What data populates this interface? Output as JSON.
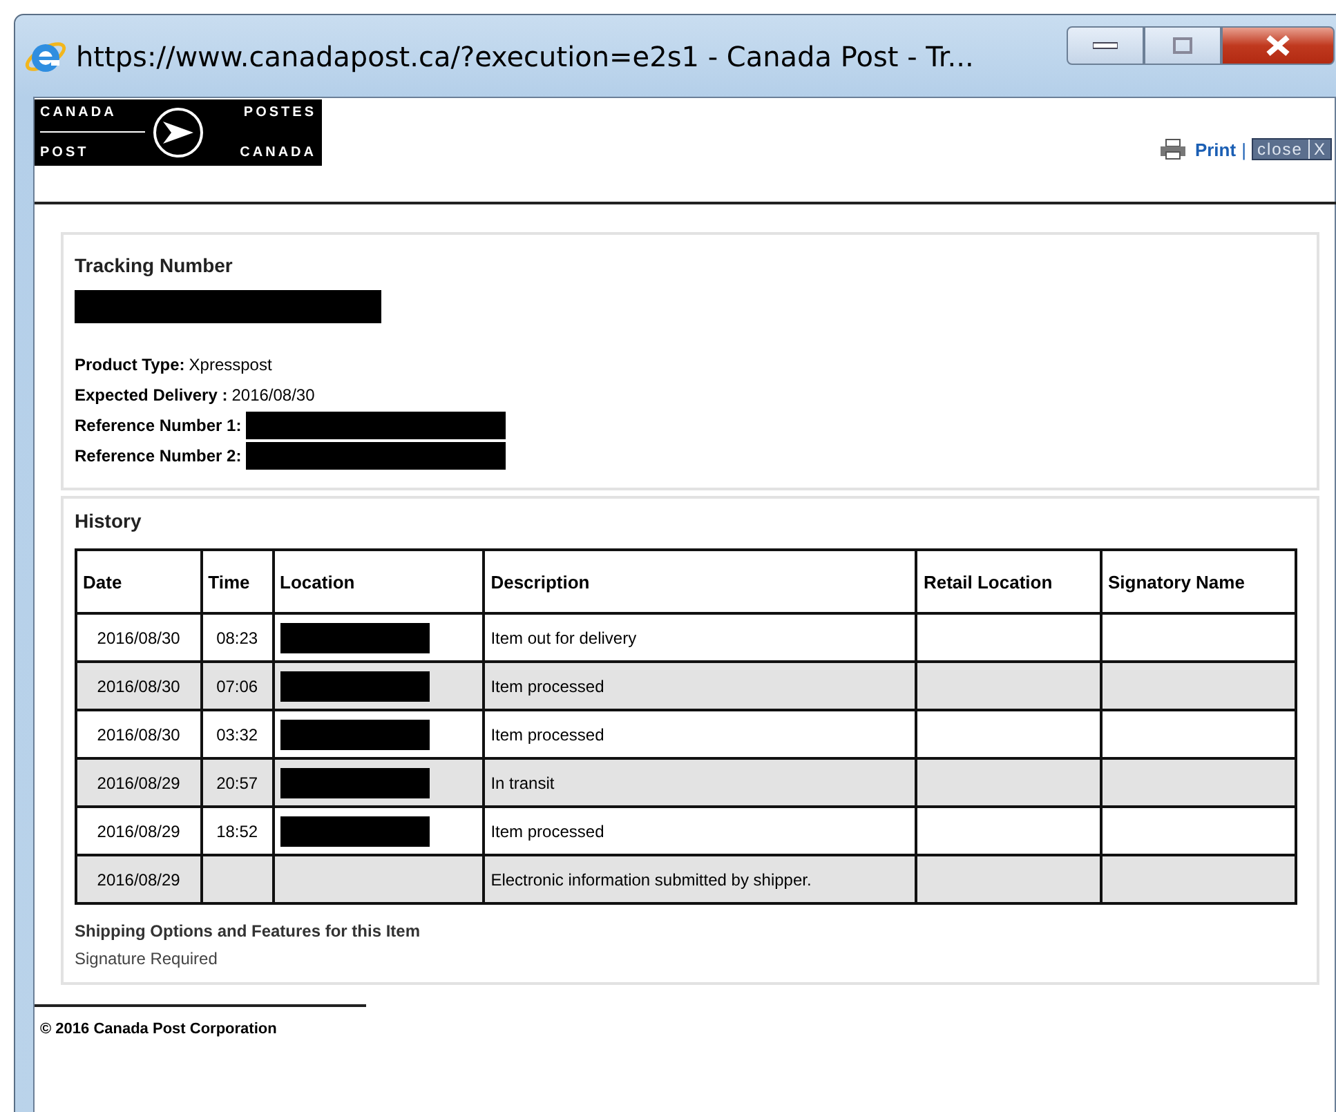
{
  "window": {
    "title": "https://www.canadapost.ca/?execution=e2s1 - Canada Post - Tr..."
  },
  "logo": {
    "top_left": "CANADA",
    "top_right": "POSTES",
    "bottom_left": "POST",
    "bottom_right": "CANADA"
  },
  "toolbar": {
    "print": "Print",
    "separator": "|",
    "close": "close",
    "close_mark": "X"
  },
  "tracking": {
    "heading": "Tracking Number",
    "number_redacted": true,
    "fields": [
      {
        "label": "Product Type:",
        "value": "Xpresspost"
      },
      {
        "label": "Expected Delivery :",
        "value": "2016/08/30"
      },
      {
        "label": "Reference Number 1:",
        "redacted": true
      },
      {
        "label": "Reference Number 2:",
        "redacted": true
      }
    ]
  },
  "history": {
    "heading": "History",
    "columns": [
      "Date",
      "Time",
      "Location",
      "Description",
      "Retail Location",
      "Signatory Name"
    ],
    "rows": [
      {
        "date": "2016/08/30",
        "time": "08:23",
        "location_redacted": true,
        "description": "Item out for delivery"
      },
      {
        "date": "2016/08/30",
        "time": "07:06",
        "location_redacted": true,
        "description": "Item processed"
      },
      {
        "date": "2016/08/30",
        "time": "03:32",
        "location_redacted": true,
        "description": "Item processed"
      },
      {
        "date": "2016/08/29",
        "time": "20:57",
        "location_redacted": true,
        "description": "In transit"
      },
      {
        "date": "2016/08/29",
        "time": "18:52",
        "location_redacted": true,
        "description": "Item processed"
      },
      {
        "date": "2016/08/29",
        "description": "Electronic information submitted by shipper."
      }
    ],
    "options_heading": "Shipping Options and Features for this Item",
    "options": [
      "Signature Required"
    ]
  },
  "footer": {
    "copyright": "© 2016 Canada Post Corporation"
  }
}
